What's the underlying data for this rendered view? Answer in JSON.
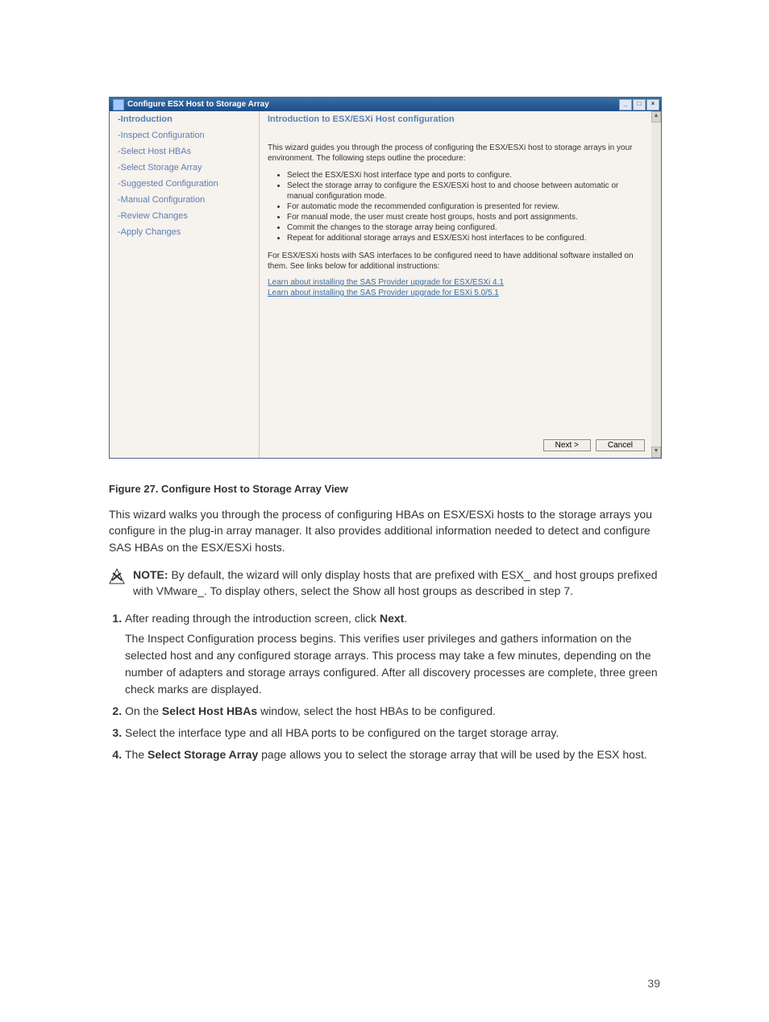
{
  "window": {
    "title": "Configure ESX Host to Storage Array",
    "buttons": {
      "min": "_",
      "max": "□",
      "close": "×"
    }
  },
  "sidebar": {
    "steps": [
      "-Introduction",
      "-Inspect Configuration",
      "-Select Host HBAs",
      "-Select Storage Array",
      "-Suggested Configuration",
      "-Manual Configuration",
      "-Review Changes",
      "-Apply Changes"
    ]
  },
  "content": {
    "title": "Introduction to ESX/ESXi Host configuration",
    "intro": "This wizard guides you through the process of configuring the ESX/ESXi host to storage arrays in your environment. The following steps outline the procedure:",
    "bullets": [
      "Select the ESX/ESXi host interface type and ports to configure.",
      "Select the storage array to configure the ESX/ESXi host to and choose between automatic or manual configuration mode.",
      "For automatic mode the recommended configuration is presented for review.",
      "For manual mode, the user must create host groups, hosts and port assignments.",
      "Commit the changes to the storage array being configured.",
      "Repeat for additional storage arrays and ESX/ESXi host interfaces to be configured."
    ],
    "sas_note": "For ESX/ESXi hosts with SAS interfaces to be configured need to have additional software installed on them. See links below for additional instructions:",
    "link1": "Learn about installing the SAS Provider upgrade for ESX/ESXi 4.1",
    "link2": "Learn about installing the SAS Provider upgrade for ESXi 5.0/5.1",
    "next": "Next >",
    "cancel": "Cancel"
  },
  "doc": {
    "caption": "Figure 27. Configure Host to Storage Array View",
    "body": "This wizard walks you through the process of configuring HBAs on ESX/ESXi hosts to the storage arrays you configure in the plug-in array manager. It also provides additional information needed to detect and configure SAS HBAs on the ESX/ESXi hosts.",
    "note_label": "NOTE:",
    "note_text": " By default, the wizard will only display hosts that are prefixed with ESX_ and host groups prefixed with VMware_. To display others, select the Show all host groups as described in step 7.",
    "step1_a": "After reading through the introduction screen, click ",
    "step1_b": "Next",
    "step1_c": ".",
    "step1_body": "The Inspect Configuration process begins. This verifies user privileges and gathers information on the selected host and any configured storage arrays. This process may take a few minutes, depending on the number of adapters and storage arrays configured. After all discovery processes are complete, three green check marks are displayed.",
    "step2_a": "On the ",
    "step2_b": "Select Host HBAs",
    "step2_c": " window, select the host HBAs to be configured.",
    "step3": "Select the interface type and all HBA ports to be configured on the target storage array.",
    "step4_a": "The ",
    "step4_b": "Select Storage Array",
    "step4_c": " page allows you to select the storage array that will be used by the ESX host.",
    "page_num": "39"
  }
}
